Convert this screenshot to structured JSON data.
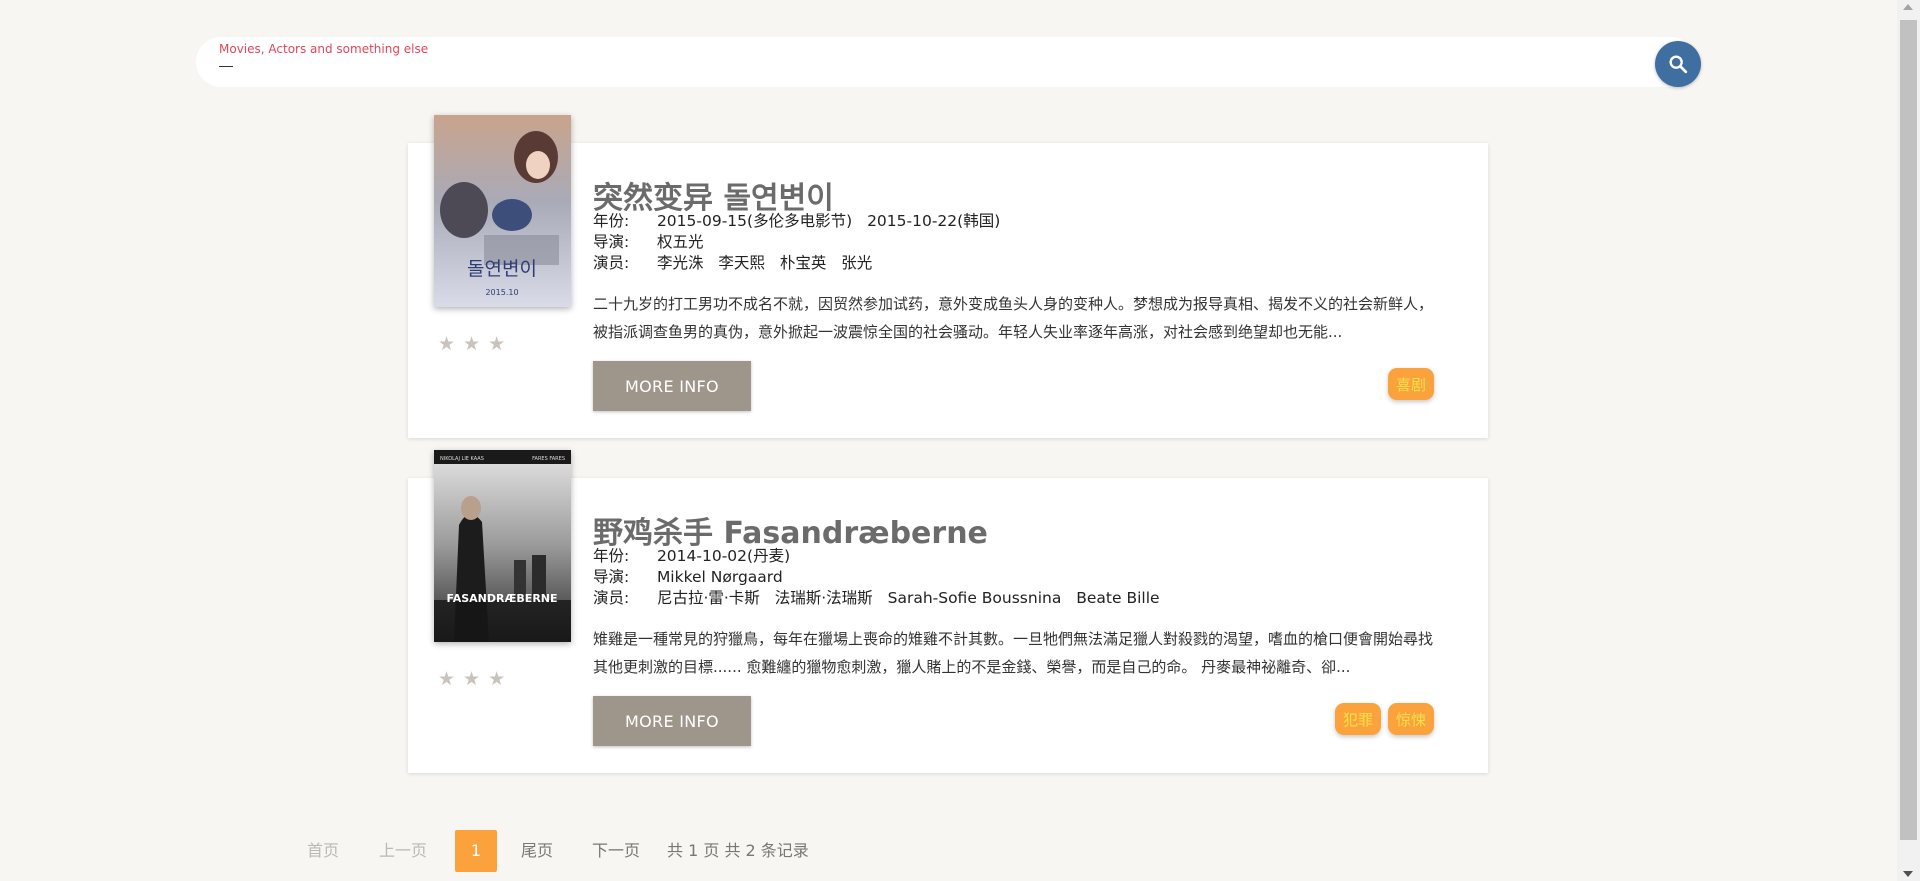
{
  "search": {
    "placeholder": "Movies, Actors and something else"
  },
  "labels": {
    "year": "年份:",
    "director": "导演:",
    "cast": "演员:"
  },
  "movies": [
    {
      "title": "突然变异 돌연변이",
      "years": [
        "2015-09-15(多伦多电影节)",
        "2015-10-22(韩国)"
      ],
      "directors": [
        "权五光"
      ],
      "cast": [
        "李光洙",
        "李天熙",
        "朴宝英",
        "张光"
      ],
      "description": "二十九岁的打工男功不成名不就，因贸然参加试药，意外变成鱼头人身的变种人。梦想成为报导真相、揭发不义的社会新鲜人，被指派调查鱼男的真伪，意外掀起一波震惊全国的社会骚动。年轻人失业率逐年高涨，对社会感到绝望却也无能...",
      "stars": "★★★",
      "button": "MORE INFO",
      "tags": [
        "喜剧"
      ],
      "poster_text": [
        "돌연변이",
        "2015.10"
      ]
    },
    {
      "title": "野鸡杀手 Fasandræberne",
      "years": [
        "2014-10-02(丹麦)"
      ],
      "directors": [
        "Mikkel Nørgaard"
      ],
      "cast": [
        "尼古拉·雷·卡斯",
        "法瑞斯·法瑞斯",
        "Sarah-Sofie Boussnina",
        "Beate Bille"
      ],
      "description": "雉雞是一種常見的狩獵鳥，每年在獵場上喪命的雉雞不計其數。一旦牠們無法滿足獵人對殺戮的渴望，嗜血的槍口便會開始尋找其他更刺激的目標...... 愈難纏的獵物愈刺激，獵人賭上的不是金錢、榮譽，而是自己的命。 丹麥最神祕離奇、卻...",
      "stars": "★★★",
      "button": "MORE INFO",
      "tags": [
        "犯罪",
        "惊悚"
      ],
      "poster_text": [
        "NIKOLAJ LIE KAAS",
        "FARES FARES",
        "FASANDRÆBERNE"
      ]
    }
  ],
  "pagination": {
    "first": "首页",
    "prev": "上一页",
    "current": "1",
    "last": "尾页",
    "next": "下一页",
    "summary": "共 1 页 共 2 条记录"
  },
  "colors": {
    "accent": "#fba23c",
    "search_button": "#3f6fa0",
    "more_button": "#9e958b",
    "background": "#f8f6f3"
  },
  "icons": {
    "search": "search-icon",
    "stars": "star-icon"
  }
}
